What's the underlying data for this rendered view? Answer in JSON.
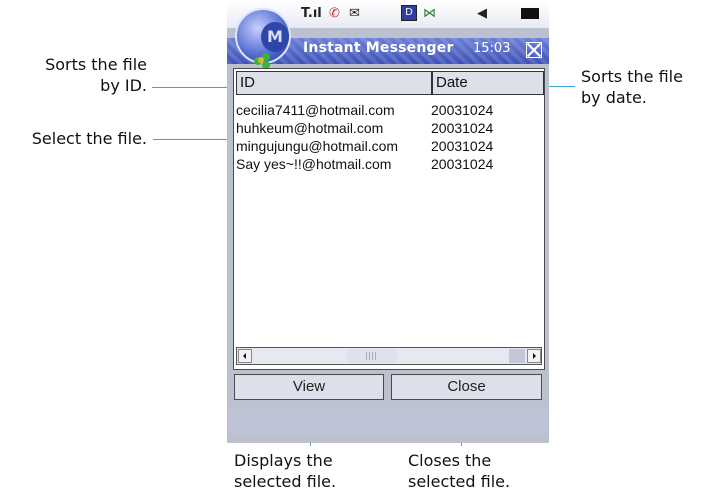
{
  "annotations": {
    "sort_by_id": [
      "Sorts the file",
      "by ID."
    ],
    "select_file": "Select the file.",
    "sort_by_date": [
      "Sorts the file",
      "by date."
    ],
    "view_desc": [
      "Displays the",
      "selected file."
    ],
    "close_desc": [
      "Closes the",
      "selected file."
    ]
  },
  "device": {
    "status_icons": [
      "signal-icon",
      "phone-icon",
      "message-icon",
      "data-icon",
      "bluetooth-icon",
      "speaker-icon",
      "battery-icon"
    ],
    "logo_letter": "M",
    "title": "Instant Messenger",
    "time": "15:03"
  },
  "table": {
    "columns": [
      "ID",
      "Date"
    ],
    "rows": [
      {
        "id": "cecilia7411@hotmail.com",
        "date": "20031024"
      },
      {
        "id": "huhkeum@hotmail.com",
        "date": "20031024"
      },
      {
        "id": "mingujungu@hotmail.com",
        "date": "20031024"
      },
      {
        "id": "Say yes~!!@hotmail.com",
        "date": "20031024"
      }
    ]
  },
  "buttons": {
    "view": "View",
    "close": "Close"
  },
  "colors": {
    "leader_line": "#3aa6d8",
    "title_bar": "#4b5fc0"
  }
}
